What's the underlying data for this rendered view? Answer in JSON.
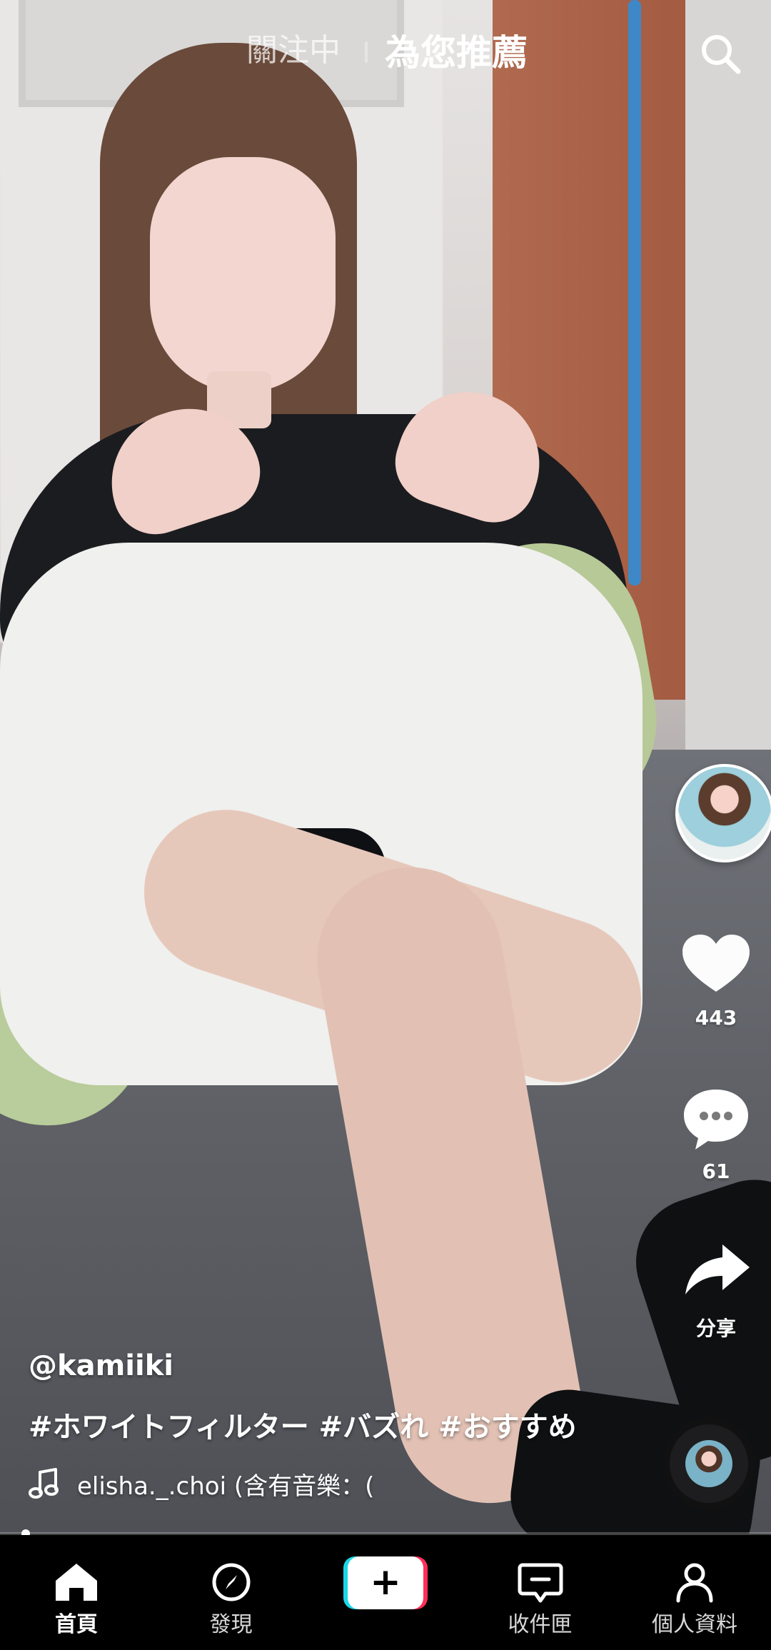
{
  "top_tabs": {
    "following": "關注中",
    "for_you": "為您推薦",
    "search_icon": "search-icon"
  },
  "video": {
    "username": "@kamiiki",
    "hashtags": "#ホワイトフィルター #バズれ #おすすめ",
    "music": "elisha._.choi (含有音樂：(",
    "progress": 0.02
  },
  "actions": {
    "likes": "443",
    "comments": "61",
    "share_label": "分享"
  },
  "bottom_nav": {
    "home": "首頁",
    "discover": "發現",
    "create_icon": "plus-icon",
    "inbox": "收件匣",
    "profile": "個人資料"
  },
  "colors": {
    "tiktok_cyan": "#19d8e6",
    "tiktok_red": "#ff2f58",
    "nav_bg": "#000000"
  }
}
